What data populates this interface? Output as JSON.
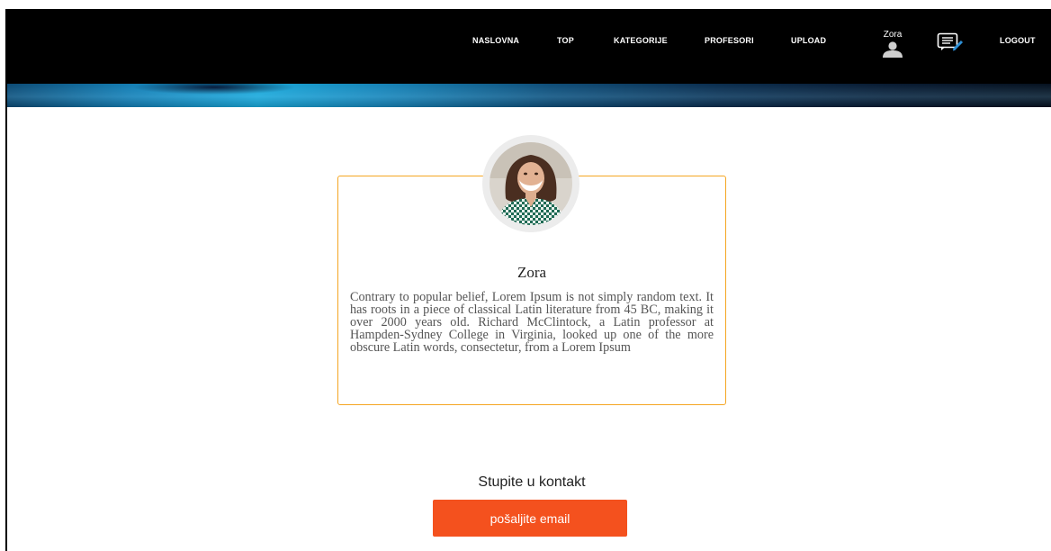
{
  "nav": {
    "items": [
      {
        "label": "NASLOVNA"
      },
      {
        "label": "TOP"
      },
      {
        "label": "KATEGORIJE"
      },
      {
        "label": "PROFESORI"
      },
      {
        "label": "UPLOAD"
      }
    ],
    "user_name": "Zora",
    "logout_label": "LOGOUT",
    "icons": [
      "user-icon",
      "message-icon"
    ]
  },
  "profile": {
    "name": "Zora",
    "bio": "Contrary to popular belief, Lorem Ipsum is not simply random text. It has roots in a piece of classical Latin literature from 45 BC, making it over 2000 years old. Richard McClintock, a Latin professor at Hampden-Sydney College in Virginia, looked up one of the more obscure Latin words, consectetur, from a Lorem Ipsum"
  },
  "contact": {
    "title": "Stupite u kontakt",
    "button_label": "pošaljite email"
  },
  "colors": {
    "navbar": "#000000",
    "card_border": "#f5a623",
    "button": "#f4511e"
  }
}
